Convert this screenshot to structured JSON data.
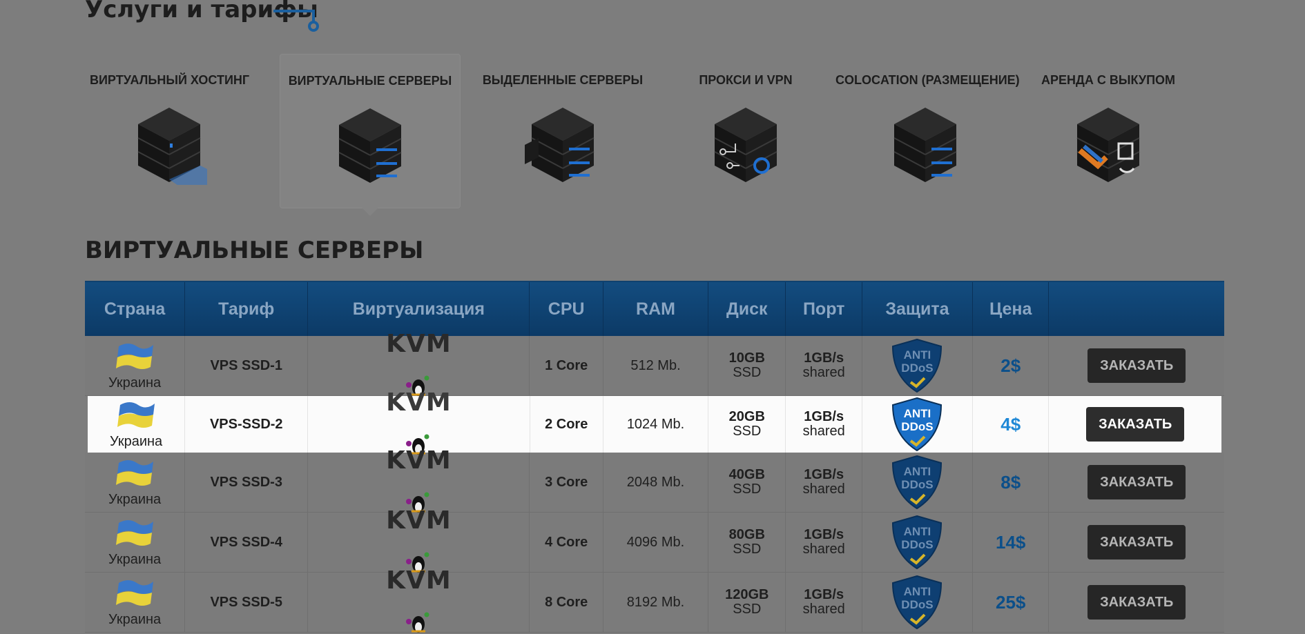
{
  "header": {
    "title": "Услуги и тарифы"
  },
  "services": [
    {
      "label": "ВИРТУАЛЬНЫЙ ХОСТИНГ",
      "icon": "server-hosting-icon"
    },
    {
      "label": "ВИРТУАЛЬНЫЕ СЕРВЕРЫ",
      "icon": "virtual-server-icon",
      "active": true
    },
    {
      "label": "ВЫДЕЛЕННЫЕ СЕРВЕРЫ",
      "icon": "dedicated-server-icon"
    },
    {
      "label": "ПРОКСИ И VPN",
      "icon": "proxy-vpn-icon"
    },
    {
      "label": "COLOCATION (РАЗМЕЩЕНИЕ)",
      "icon": "colocation-icon"
    },
    {
      "label": "АРЕНДА С ВЫКУПОМ",
      "icon": "lease-buyout-icon"
    }
  ],
  "section": {
    "title": "ВИРТУАЛЬНЫЕ СЕРВЕРЫ"
  },
  "table": {
    "headers": [
      "Страна",
      "Тариф",
      "Виртуализация",
      "CPU",
      "RAM",
      "Диск",
      "Порт",
      "Защита",
      "Цена",
      ""
    ],
    "rows": [
      {
        "country": "Украина",
        "plan": "VPS SSD-1",
        "virt": "KVM",
        "cpu": "1 Core",
        "ram": "512 Mb.",
        "disk_size": "10GB",
        "disk_type": "SSD",
        "port_speed": "1GB/s",
        "port_type": "shared",
        "protection_top": "ANTI",
        "protection_bottom": "DDoS",
        "price": "2$",
        "order": "ЗАКАЗАТЬ"
      },
      {
        "country": "Украина",
        "plan": "VPS-SSD-2",
        "virt": "KVM",
        "cpu": "2 Core",
        "ram": "1024 Mb.",
        "disk_size": "20GB",
        "disk_type": "SSD",
        "port_speed": "1GB/s",
        "port_type": "shared",
        "protection_top": "ANTI",
        "protection_bottom": "DDoS",
        "price": "4$",
        "order": "ЗАКАЗАТЬ",
        "highlight": true
      },
      {
        "country": "Украина",
        "plan": "VPS SSD-3",
        "virt": "KVM",
        "cpu": "3 Core",
        "ram": "2048 Mb.",
        "disk_size": "40GB",
        "disk_type": "SSD",
        "port_speed": "1GB/s",
        "port_type": "shared",
        "protection_top": "ANTI",
        "protection_bottom": "DDoS",
        "price": "8$",
        "order": "ЗАКАЗАТЬ"
      },
      {
        "country": "Украина",
        "plan": "VPS SSD-4",
        "virt": "KVM",
        "cpu": "4 Core",
        "ram": "4096 Mb.",
        "disk_size": "80GB",
        "disk_type": "SSD",
        "port_speed": "1GB/s",
        "port_type": "shared",
        "protection_top": "ANTI",
        "protection_bottom": "DDoS",
        "price": "14$",
        "order": "ЗАКАЗАТЬ"
      },
      {
        "country": "Украина",
        "plan": "VPS SSD-5",
        "virt": "KVM",
        "cpu": "8 Core",
        "ram": "8192 Mb.",
        "disk_size": "120GB",
        "disk_type": "SSD",
        "port_speed": "1GB/s",
        "port_type": "shared",
        "protection_top": "ANTI",
        "protection_bottom": "DDoS",
        "price": "25$",
        "order": "ЗАКАЗАТЬ"
      }
    ]
  },
  "colors": {
    "header_blue": "#0f416f",
    "price_blue": "#1e88d6",
    "accent_line": "#2a7fcf"
  }
}
